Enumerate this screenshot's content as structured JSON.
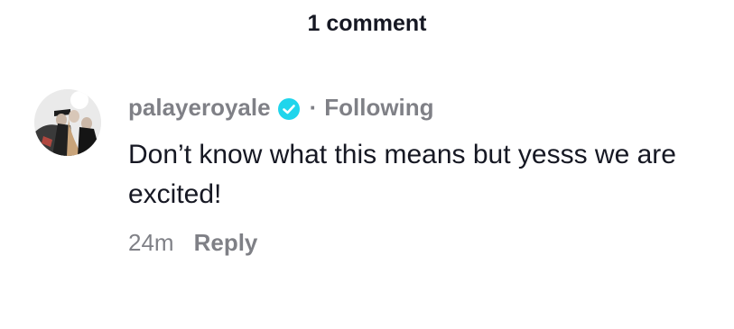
{
  "header": {
    "title": "1 comment"
  },
  "comment": {
    "avatar_icon": "band-photo-avatar",
    "username": "palayeroyale",
    "verified_icon": "verified-check-icon",
    "verified_color": "#20D5EC",
    "separator": "·",
    "relationship": "Following",
    "text": "Don’t know what this means but yesss we are excited!",
    "timestamp": "24m",
    "reply_label": "Reply"
  }
}
